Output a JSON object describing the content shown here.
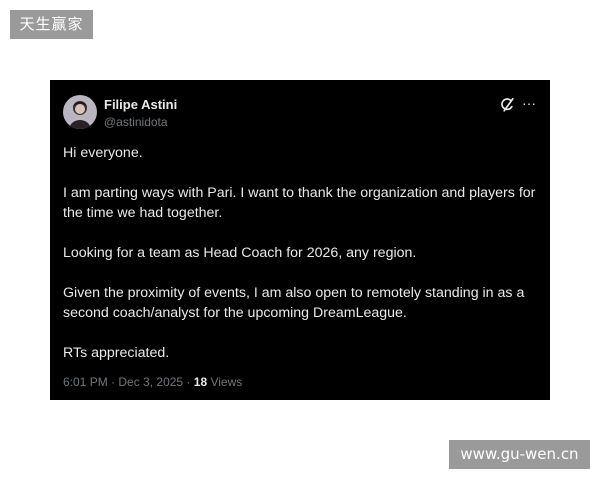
{
  "watermarks": {
    "top_left": "天生赢家",
    "bottom_right": "www.gu-wen.cn"
  },
  "tweet": {
    "author": {
      "name": "Filipe Astini",
      "handle": "@astinidota"
    },
    "body": [
      "Hi everyone.",
      "I am parting ways with Pari. I want to thank the organization and players for the time we had together.",
      "Looking for a team as Head Coach for 2026, any region.",
      "Given the proximity of events, I am also open to remotely standing in as a second coach/analyst for the upcoming DreamLeague.",
      "RTs appreciated."
    ],
    "time": "6:01 PM",
    "separator": " · ",
    "date": "Dec 3, 2025",
    "views_count": "18",
    "views_label": " Views",
    "more_glyph": "···"
  },
  "colors": {
    "card_background": "#000000",
    "text_primary": "#e7e9ea",
    "text_secondary": "#71767b",
    "watermark_background": "#9a9a9a"
  },
  "icons": {
    "avatar": "avatar",
    "grok": "grok-icon",
    "more": "more-options-icon"
  }
}
